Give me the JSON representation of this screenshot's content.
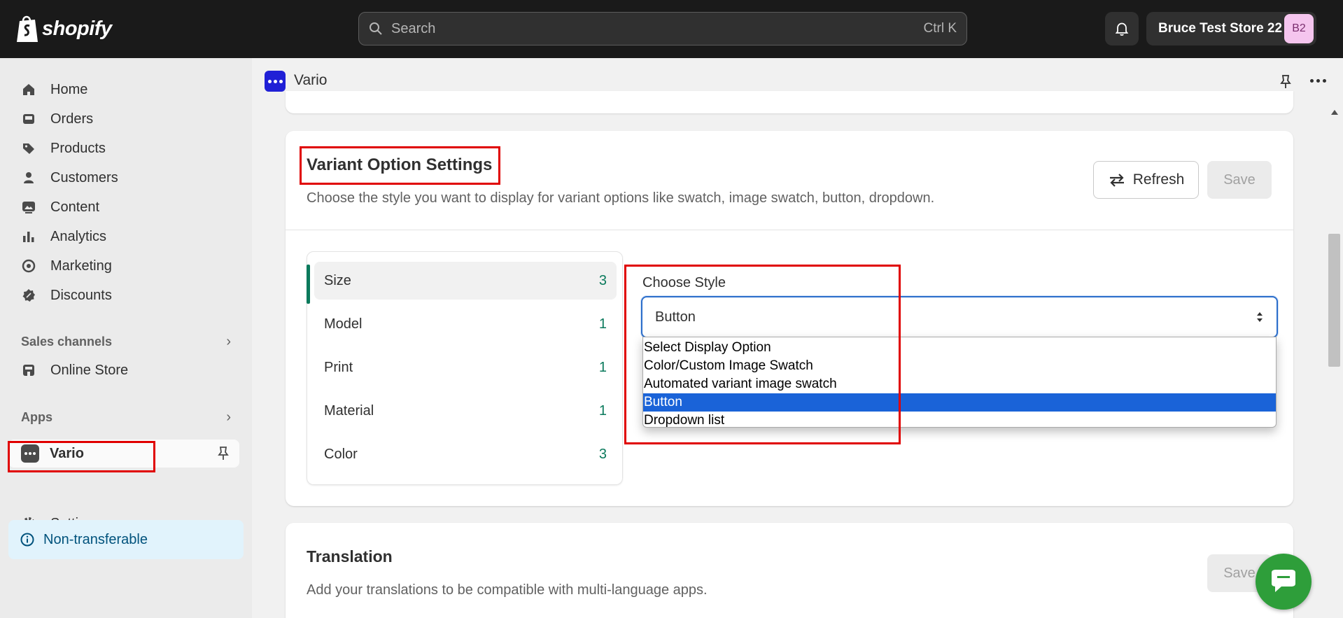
{
  "topbar": {
    "brand": "shopify",
    "search_placeholder": "Search",
    "search_shortcut": "Ctrl K",
    "store_name": "Bruce Test Store 22",
    "store_initials": "B2"
  },
  "sidebar": {
    "items": [
      {
        "label": "Home",
        "icon": "home-icon"
      },
      {
        "label": "Orders",
        "icon": "inbox-icon"
      },
      {
        "label": "Products",
        "icon": "tag-icon"
      },
      {
        "label": "Customers",
        "icon": "person-icon"
      },
      {
        "label": "Content",
        "icon": "image-icon"
      },
      {
        "label": "Analytics",
        "icon": "bar-chart-icon"
      },
      {
        "label": "Marketing",
        "icon": "target-icon"
      },
      {
        "label": "Discounts",
        "icon": "discount-icon"
      }
    ],
    "sales_channels_label": "Sales channels",
    "online_store_label": "Online Store",
    "apps_label": "Apps",
    "vario_label": "Vario",
    "settings_label": "Settings",
    "non_transferable_label": "Non-transferable"
  },
  "app_header": {
    "title": "Vario"
  },
  "variant_card": {
    "title": "Variant Option Settings",
    "subtitle": "Choose the style you want to display for variant options like swatch, image swatch, button, dropdown.",
    "refresh_label": "Refresh",
    "save_label": "Save",
    "options": [
      {
        "name": "Size",
        "count": "3"
      },
      {
        "name": "Model",
        "count": "1"
      },
      {
        "name": "Print",
        "count": "1"
      },
      {
        "name": "Material",
        "count": "1"
      },
      {
        "name": "Color",
        "count": "3"
      }
    ],
    "choose_style_label": "Choose Style",
    "selected_style": "Button",
    "style_options": [
      "Select Display Option",
      "Color/Custom Image Swatch",
      "Automated variant image swatch",
      "Button",
      "Dropdown list"
    ]
  },
  "translation_card": {
    "title": "Translation",
    "subtitle": "Add your translations to be compatible with multi-language apps.",
    "save_label": "Save"
  },
  "colors": {
    "accent_green": "#0b7a5c",
    "highlight_red": "#e00000",
    "select_blue": "#1a63d8",
    "chat_green": "#2e9e3a"
  }
}
